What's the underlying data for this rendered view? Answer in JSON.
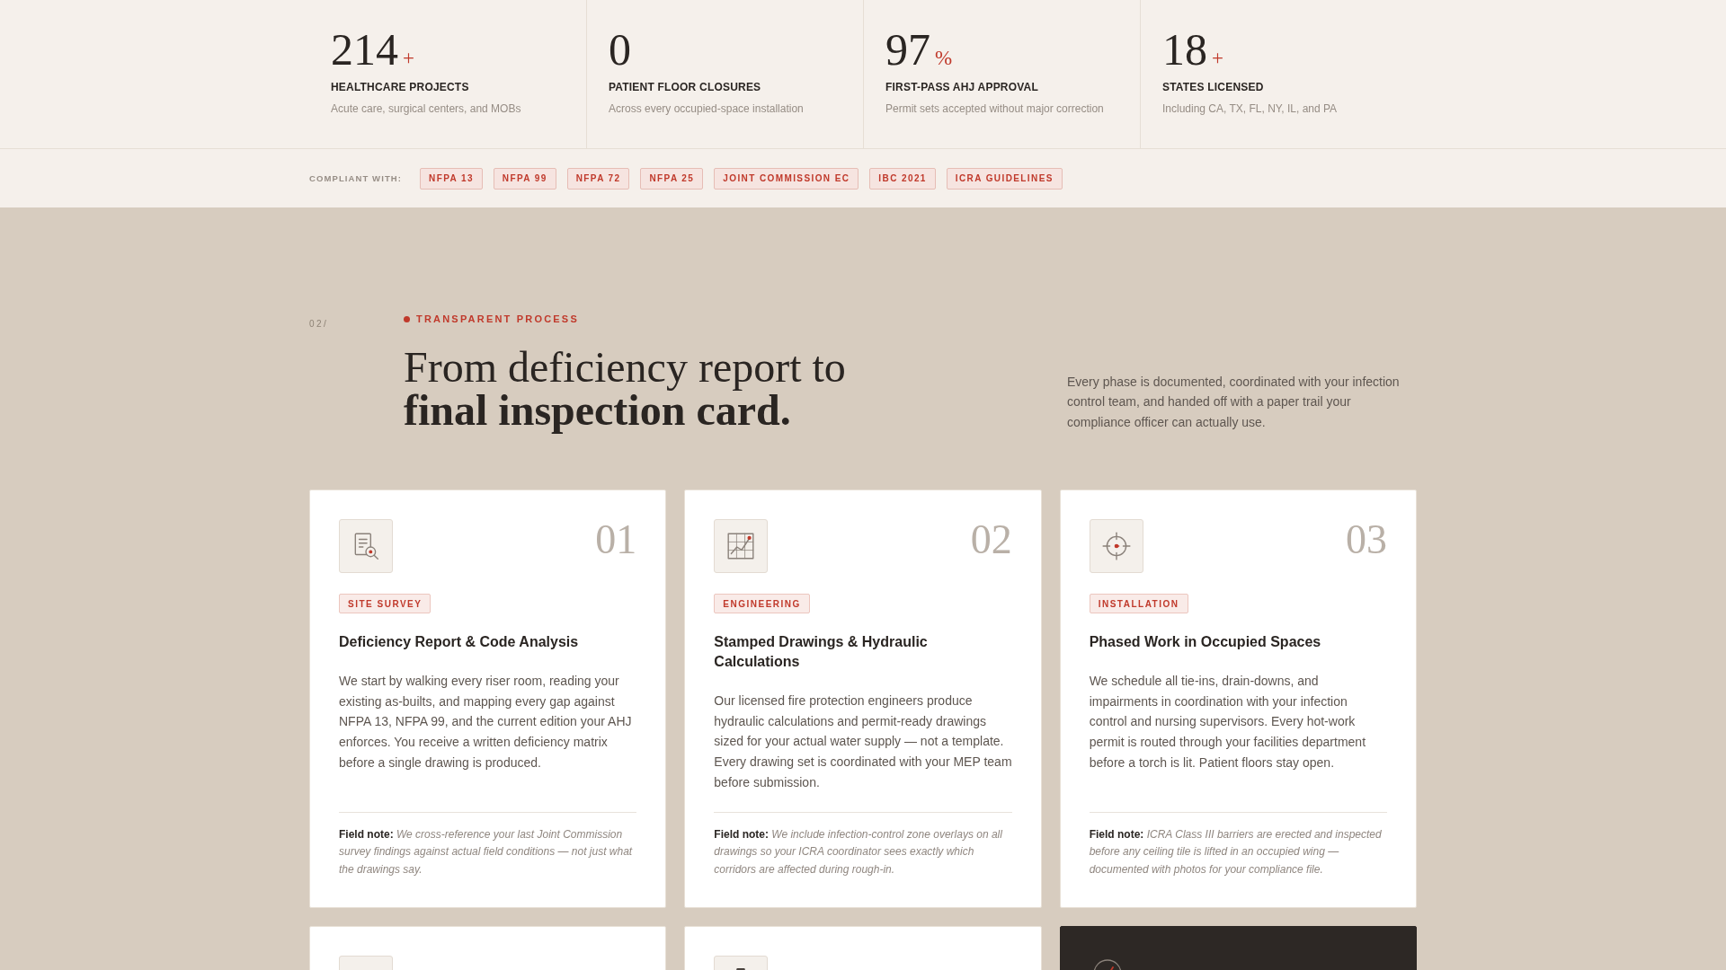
{
  "stats": [
    {
      "value": "214",
      "suffix": "+",
      "label": "HEALTHCARE PROJECTS",
      "description": "Acute care, surgical centers, and MOBs"
    },
    {
      "value": "0",
      "label": "PATIENT FLOOR CLOSURES",
      "description": "Across every occupied-space installation"
    },
    {
      "value": "97",
      "suffix": "%",
      "label": "FIRST-PASS AHJ APPROVAL",
      "description": "Permit sets accepted without major correction"
    },
    {
      "value": "18",
      "suffix": "+",
      "label": "STATES LICENSED",
      "description": "Including CA, TX, FL, NY, IL, and PA"
    }
  ],
  "compliance": {
    "label": "COMPLIANT WITH:",
    "standards": [
      "NFPA 13",
      "NFPA 99",
      "NFPA 72",
      "NFPA 25",
      "JOINT COMMISSION EC",
      "IBC 2021",
      "ICRA GUIDELINES"
    ]
  },
  "process": {
    "index": "02/",
    "eyebrow": "TRANSPARENT PROCESS",
    "heading": "From deficiency report to **final inspection card.**",
    "intro": "Every phase is documented, coordinated with your infection control team, and handed off with a paper trail your compliance officer can actually use."
  },
  "cards": [
    {
      "kind": "step",
      "number": "01",
      "tag": "SITE SURVEY",
      "title": "Deficiency Report & Code Analysis",
      "body": "We start by walking every riser room, reading your existing as-builts, and mapping every gap against NFPA 13, NFPA 99, and the current edition your AHJ enforces. You receive a written deficiency matrix before a single drawing is produced.",
      "note": "**Field note:** We cross-reference your last Joint Commission survey findings against actual field conditions — not just what the drawings say."
    },
    {
      "kind": "step",
      "number": "02",
      "tag": "ENGINEERING",
      "title": "Stamped Drawings & Hydraulic Calculations",
      "body": "Our licensed fire protection engineers produce hydraulic calculations and permit-ready drawings sized for your actual water supply — not a template. Every drawing set is coordinated with your MEP team before submission.",
      "note": "**Field note:** We include infection-control zone overlays on all drawings so your ICRA coordinator sees exactly which corridors are affected during rough-in."
    },
    {
      "kind": "step",
      "number": "03",
      "tag": "INSTALLATION",
      "title": "Phased Work in Occupied Spaces",
      "body": "We schedule all tie-ins, drain-downs, and impairments in coordination with your infection control and nursing supervisors. Every hot-work permit is routed through your facilities department before a torch is lit. Patient floors stay open.",
      "note": "**Field note:** ICRA Class III barriers are erected and inspected before any ceiling tile is lifted in an occupied wing — documented with photos for your compliance file."
    },
    {
      "kind": "step"
    },
    {
      "kind": "step"
    },
    {
      "kind": "dark"
    }
  ]
}
